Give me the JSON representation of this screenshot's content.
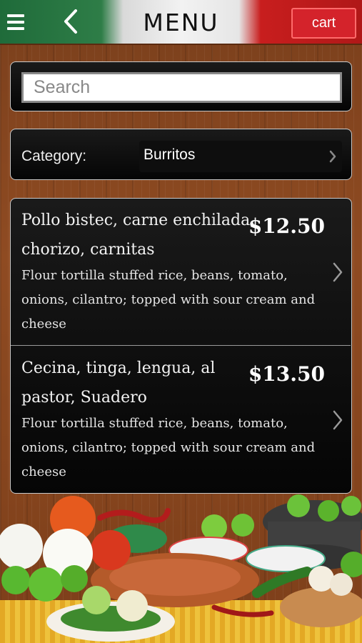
{
  "header": {
    "title": "MENU",
    "cart_label": "cart",
    "menu_icon": "hamburger-icon",
    "back_icon": "chevron-left-icon"
  },
  "search": {
    "placeholder": "Search"
  },
  "category": {
    "label": "Category:",
    "selected": "Burritos"
  },
  "items": [
    {
      "name": "Pollo bistec, carne enchilada, chorizo, carnitas",
      "price": "$12.50",
      "description": "Flour tortilla stuffed rice, beans, tomato, onions, cilantro; topped with sour cream and cheese"
    },
    {
      "name": "Cecina, tinga, lengua, al pastor, Suadero",
      "price": "$13.50",
      "description": "Flour tortilla stuffed rice, beans, tomato, onions, cilantro; topped with sour cream and cheese"
    }
  ],
  "colors": {
    "flag_green": "#2e7d47",
    "flag_white": "#f2f2f2",
    "flag_red": "#c81e1e",
    "cart_red": "#d4232b",
    "panel_black": "#0a0a0a",
    "wood": "#8f4b22"
  }
}
